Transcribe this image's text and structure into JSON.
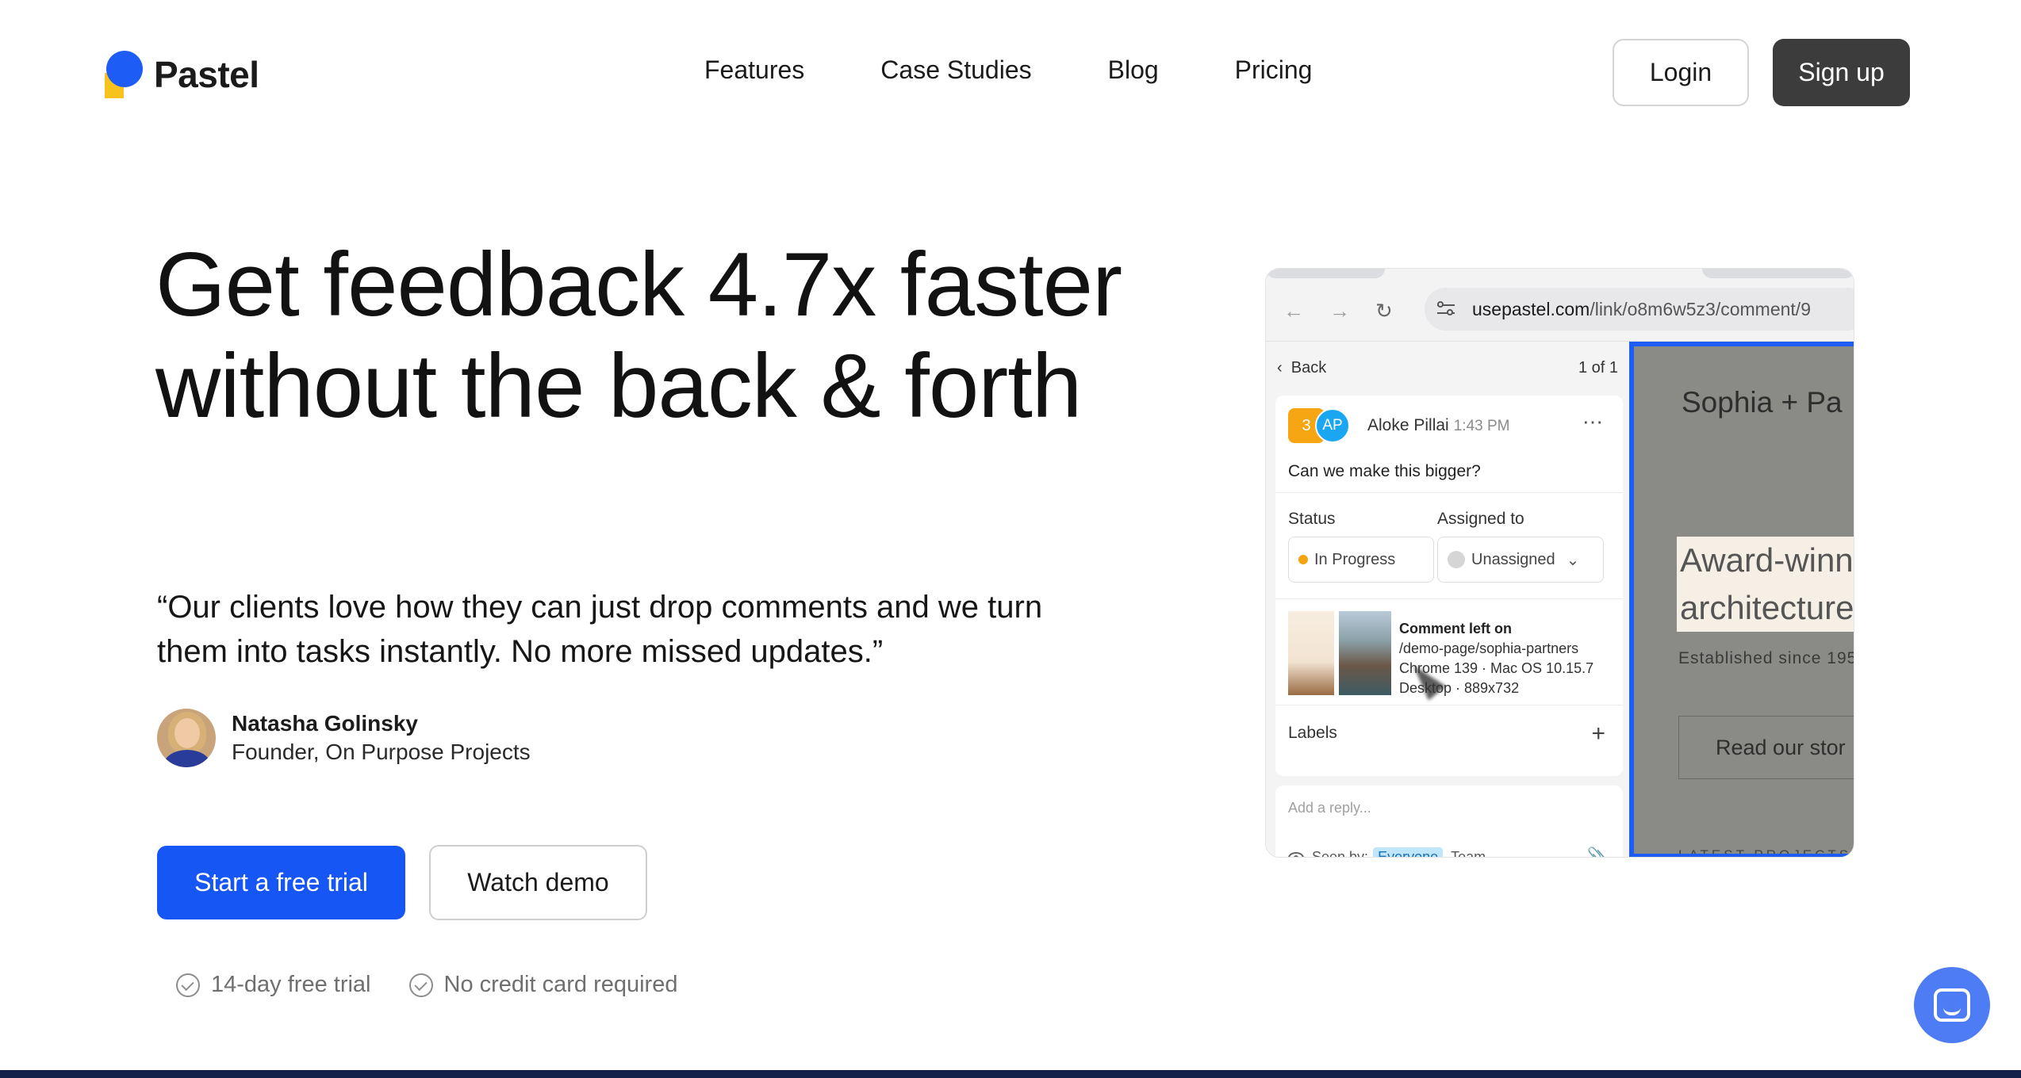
{
  "brand": {
    "name": "Pastel"
  },
  "nav": {
    "items": [
      "Features",
      "Case Studies",
      "Blog",
      "Pricing"
    ]
  },
  "header": {
    "login_label": "Login",
    "signup_label": "Sign up"
  },
  "hero": {
    "title": "Get feedback 4.7x faster without the back & forth",
    "quote": "“Our clients love how they can just drop comments and we turn them into tasks instantly. No more missed updates.”",
    "author_name": "Natasha Golinsky",
    "author_role": "Founder, On Purpose Projects",
    "cta_primary": "Start a free trial",
    "cta_secondary": "Watch demo",
    "perks": [
      "14-day free trial",
      "No credit card required"
    ]
  },
  "product_shot": {
    "url_host": "usepastel.com",
    "url_path": "/link/o8m6w5z3/comment/9",
    "back_label": "Back",
    "pager": "1 of 1",
    "comment": {
      "number": "3",
      "initials": "AP",
      "author": "Aloke Pillai",
      "time": "1:43 PM",
      "message": "Can we make this bigger?",
      "status_label": "Status",
      "status_value": "In Progress",
      "assigned_label": "Assigned to",
      "assigned_value": "Unassigned",
      "meta_title": "Comment left on",
      "meta_path": "/demo-page/sophia-partners",
      "meta_browser": "Chrome 139 · Mac OS 10.15.7",
      "meta_device": "Desktop · 889x732",
      "labels_label": "Labels"
    },
    "reply": {
      "placeholder": "Add a reply...",
      "seen_by": "Seen by:",
      "everyone": "Everyone",
      "team": "Team"
    },
    "site": {
      "title": "Sophia + Pa",
      "headline_1": "Award-winn",
      "headline_2": "architecture",
      "established": "Established since 195",
      "button": "Read our stor",
      "latest": "LATEST PROJECTS"
    }
  },
  "colors": {
    "accent": "#1656f5",
    "dark_button": "#3c3c3c",
    "logo_yellow": "#f8c21c"
  }
}
